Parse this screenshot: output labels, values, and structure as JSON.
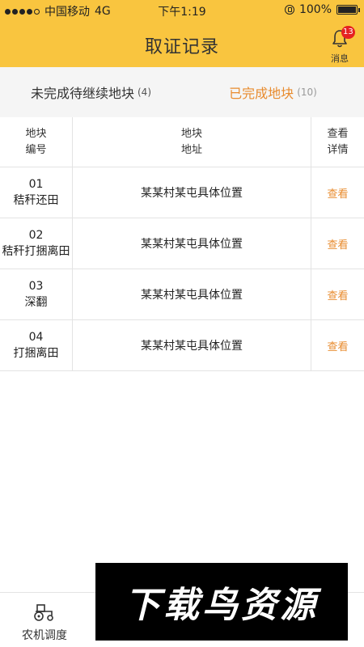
{
  "status_bar": {
    "carrier": "中国移动",
    "network": "4G",
    "time": "下午1:19",
    "battery": "100%",
    "battery_level": 1.0
  },
  "header": {
    "title": "取证记录",
    "messages_label": "消息",
    "messages_badge": "13"
  },
  "tabs": [
    {
      "label": "未完成待继续地块",
      "count": "(4)",
      "active": false
    },
    {
      "label": "已完成地块",
      "count": "(10)",
      "active": true
    }
  ],
  "table": {
    "columns": [
      {
        "line1": "地块",
        "line2": "编号"
      },
      {
        "line1": "地块",
        "line2": "地址"
      },
      {
        "line1": "查看",
        "line2": "详情"
      }
    ],
    "rows": [
      {
        "id": "01",
        "type": "秸秆还田",
        "address": "某某村某屯具体位置",
        "action": "查看"
      },
      {
        "id": "02",
        "type": "秸秆打捆离田",
        "address": "某某村某屯具体位置",
        "action": "查看"
      },
      {
        "id": "03",
        "type": "深翻",
        "address": "某某村某屯具体位置",
        "action": "查看"
      },
      {
        "id": "04",
        "type": "打捆离田",
        "address": "某某村某屯具体位置",
        "action": "查看"
      }
    ]
  },
  "bottom_nav": {
    "items": [
      {
        "label": "农机调度",
        "icon": "tractor-icon"
      }
    ]
  },
  "watermark": {
    "text": "下载鸟资源"
  },
  "colors": {
    "header_bg": "#f9c53f",
    "accent": "#e88b2e",
    "badge": "#e62222"
  }
}
